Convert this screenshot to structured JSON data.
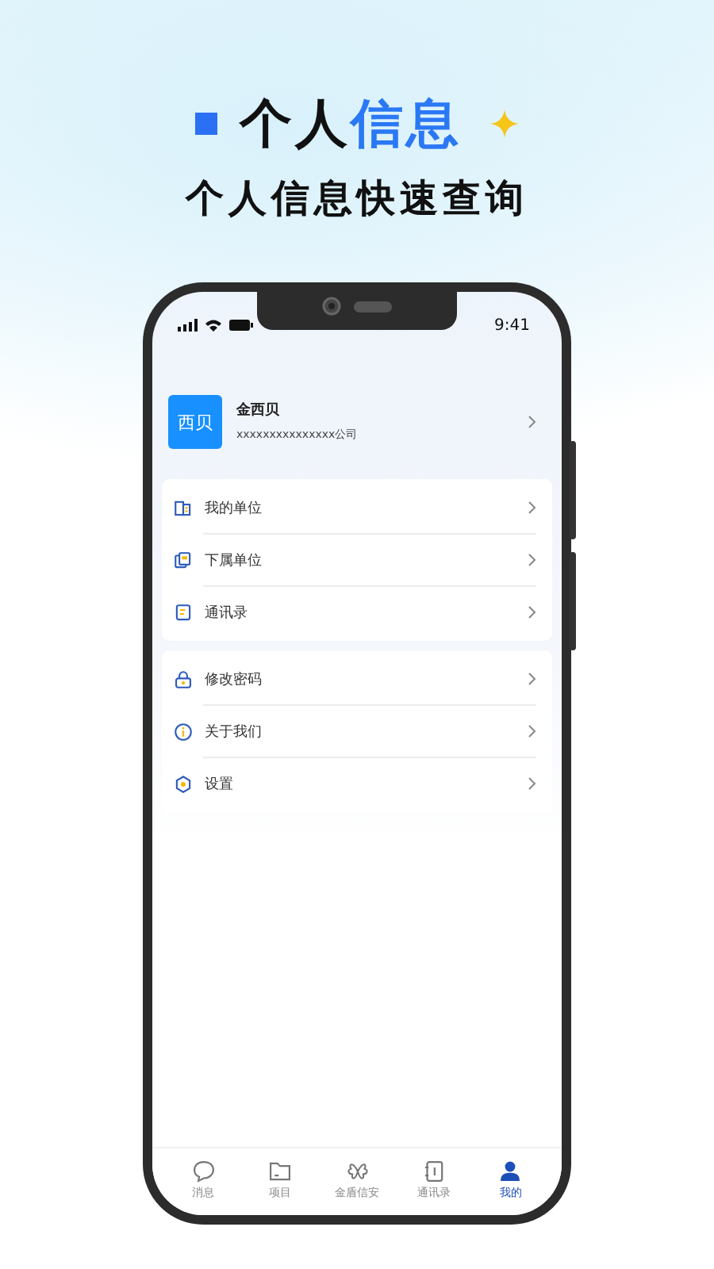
{
  "banner": {
    "title": [
      {
        "text": "个人",
        "accent": false
      },
      {
        "text": "信息",
        "accent": true
      }
    ],
    "subtitle": "个人信息快速查询"
  },
  "status_bar": {
    "time": "9:41"
  },
  "profile": {
    "avatar": "西贝",
    "name": "金西贝",
    "company": "xxxxxxxxxxxxxxx公司"
  },
  "menu_groups": [
    {
      "items": [
        {
          "kind": "unit",
          "label": "我的单位"
        },
        {
          "kind": "subunit",
          "label": "下属单位"
        },
        {
          "kind": "contacts",
          "label": "通讯录"
        }
      ]
    },
    {
      "items": [
        {
          "kind": "lock",
          "label": "修改密码"
        },
        {
          "kind": "info",
          "label": "关于我们"
        },
        {
          "kind": "settings",
          "label": "设置"
        }
      ]
    }
  ],
  "tab_bar": [
    {
      "kind": "chat",
      "label": "消息",
      "selected": false
    },
    {
      "kind": "folder",
      "label": "项目",
      "selected": false
    },
    {
      "kind": "shield",
      "label": "金盾信安",
      "selected": false
    },
    {
      "kind": "book",
      "label": "通讯录",
      "selected": false
    },
    {
      "kind": "person",
      "label": "我的",
      "selected": true
    }
  ]
}
